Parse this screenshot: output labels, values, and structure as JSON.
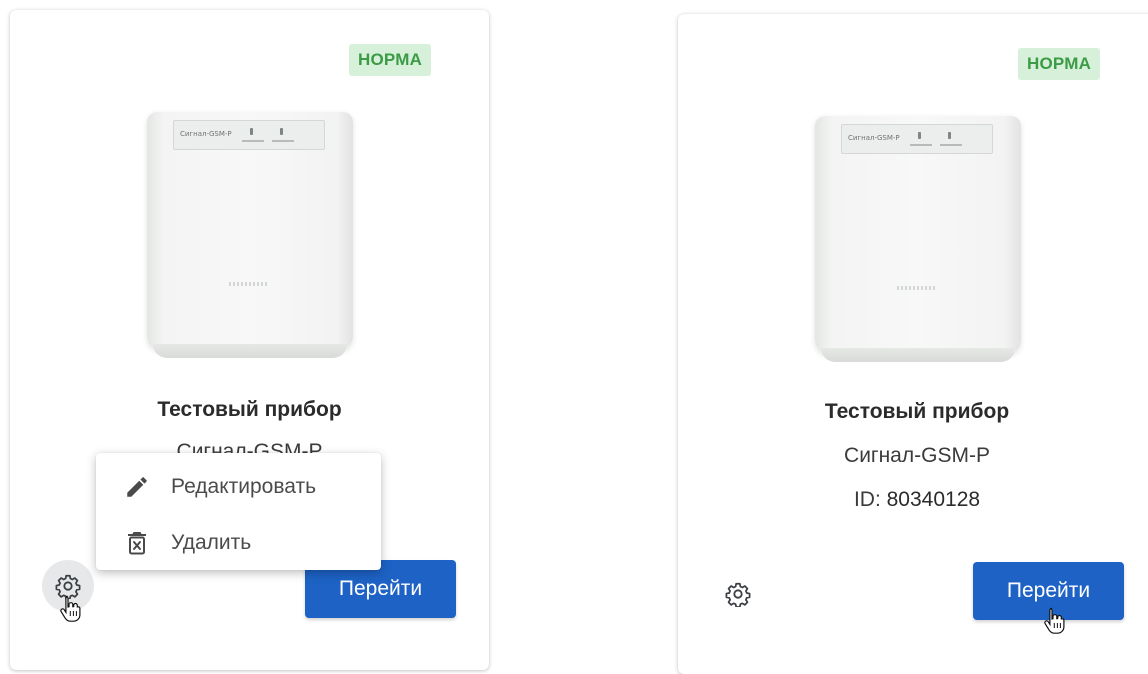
{
  "cards": [
    {
      "status": "НОРМА",
      "name": "Тестовый прибор",
      "model": "Сигнал-GSM-P",
      "go_label": "Перейти",
      "device_panel_text": "Сигнал-GSM-P",
      "menu": {
        "items": [
          {
            "label": "Редактировать",
            "icon": "pencil-icon"
          },
          {
            "label": "Удалить",
            "icon": "trash-icon"
          }
        ]
      }
    },
    {
      "status": "НОРМА",
      "name": "Тестовый прибор",
      "model": "Сигнал-GSM-P",
      "id_label": "ID:",
      "id_value": "80340128",
      "go_label": "Перейти",
      "device_panel_text": "Сигнал-GSM-P"
    }
  ],
  "colors": {
    "status_bg": "#d7f0d9",
    "status_text": "#3c9b46",
    "primary_button": "#1d62c4"
  }
}
